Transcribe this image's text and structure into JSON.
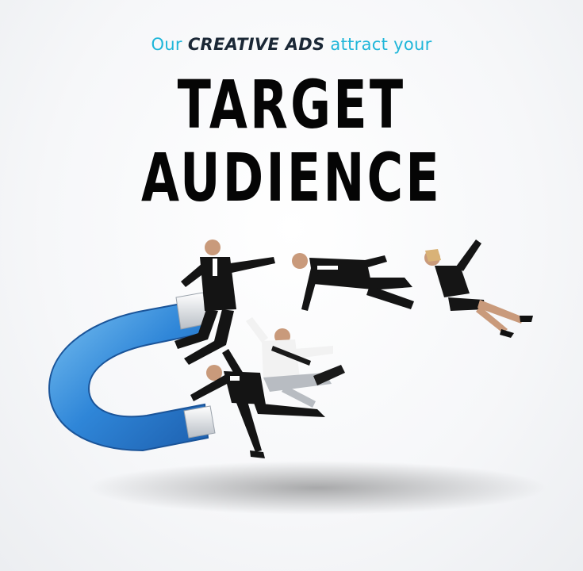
{
  "tagline": {
    "part1": "Our ",
    "part2": "CREATIVE ADS",
    "part3": " attract your"
  },
  "headline": {
    "line1": "TARGET",
    "line2": "AUDIENCE"
  },
  "colors": {
    "accent_cyan": "#1fb6d9",
    "dark_text": "#1b2836",
    "magnet_blue": "#2f86d8",
    "magnet_silver": "#d9dde2"
  },
  "icons": [
    "magnet-icon",
    "businessperson-figure"
  ]
}
